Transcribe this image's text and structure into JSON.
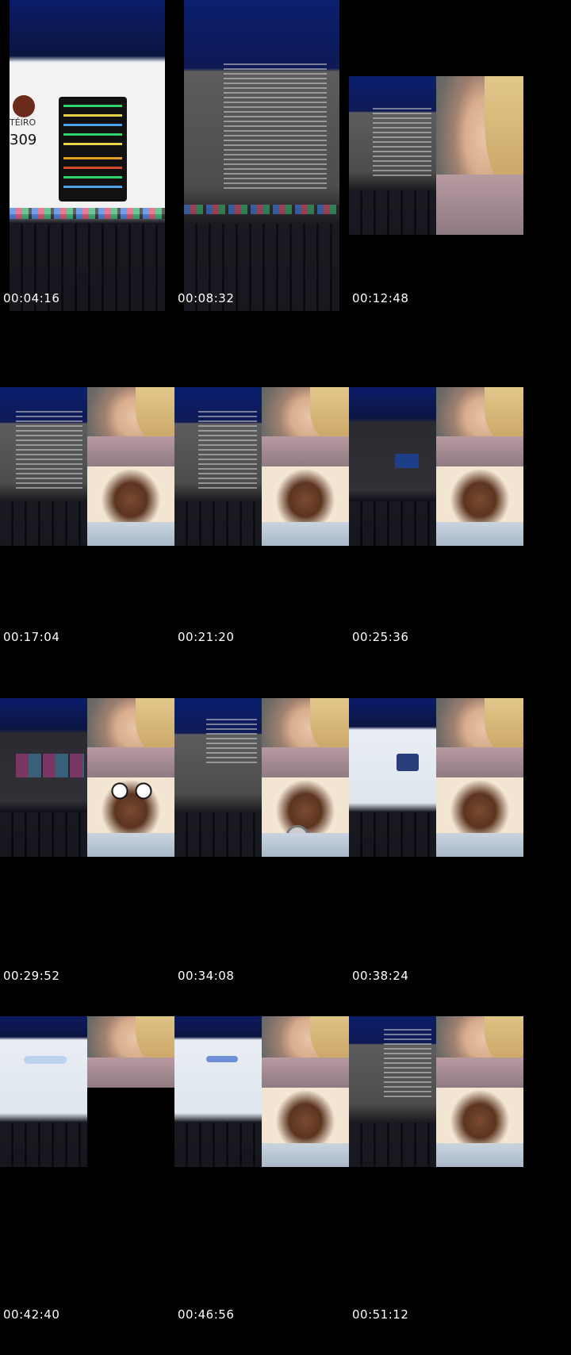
{
  "timestamps": [
    "00:04:16",
    "00:08:32",
    "00:12:48",
    "00:17:04",
    "00:21:20",
    "00:25:36",
    "00:29:52",
    "00:34:08",
    "00:38:24",
    "00:42:40",
    "00:46:56",
    "00:51:12"
  ],
  "frame1": {
    "counter_text": "309",
    "brand_text": "TÉIRO"
  }
}
